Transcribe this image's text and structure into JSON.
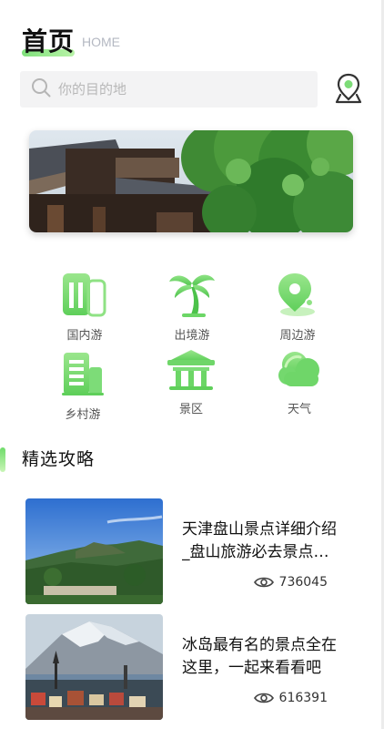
{
  "header": {
    "title": "首页",
    "subtitle": "HOME"
  },
  "search": {
    "placeholder": "你的目的地"
  },
  "categories": [
    {
      "label": "国内游",
      "icon": "building-icon"
    },
    {
      "label": "出境游",
      "icon": "palm-tree-icon"
    },
    {
      "label": "周边游",
      "icon": "map-pin-icon"
    },
    {
      "label": "乡村游",
      "icon": "village-building-icon"
    },
    {
      "label": "景区",
      "icon": "pavilion-icon"
    },
    {
      "label": "天气",
      "icon": "cloud-icon"
    }
  ],
  "section": {
    "title": "精选攻略"
  },
  "articles": [
    {
      "title": "天津盘山景点详细介绍_盘山旅游必去景点推荐",
      "views": "736045"
    },
    {
      "title": "冰岛最有名的景点全在这里，一起来看看吧",
      "views": "616391"
    }
  ],
  "colors": {
    "accent": "#7ddc78",
    "accent_light": "#c9f5b7"
  }
}
